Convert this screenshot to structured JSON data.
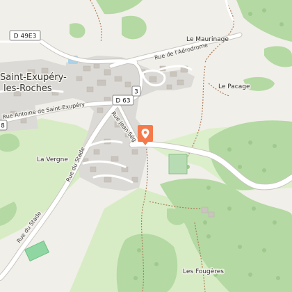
{
  "map": {
    "colors": {
      "background": "#f1efe9",
      "field": "#d7ecc4",
      "forest": "#b4d9a3",
      "forest_dark": "#a9d096",
      "residential": "#dcdad6",
      "building": "#c9c4bd",
      "road": "#ffffff",
      "road_casing": "#c9c6c0",
      "path": "#b07c5a",
      "water": "#a8d3ea",
      "pitch": "#8fd6a2",
      "marker": "#f47a4b"
    },
    "labels": {
      "town": [
        "Saint-Exupéry-",
        "les-Roches"
      ],
      "le_mauringe": "Le Maurinage",
      "le_pacage": "Le Pacage",
      "la_vergne": "La Vergne",
      "les_fougeres": "Les Fougères",
      "rue_aerodrome": "Rue de l'Aérodrome",
      "rue_antoine": "Rue Antoine de Saint-Exupéry",
      "rue_stade_upper": "Rue du Stade",
      "rue_stade_lower": "Rue du Stade",
      "rue_jean": "Rue Jean Ség"
    },
    "shields": {
      "d49e3": "D 49E3",
      "d63": "D 63",
      "d63_partial": "3",
      "edge_partial": "8"
    },
    "marker": {
      "icon": "map-pin-icon"
    }
  }
}
